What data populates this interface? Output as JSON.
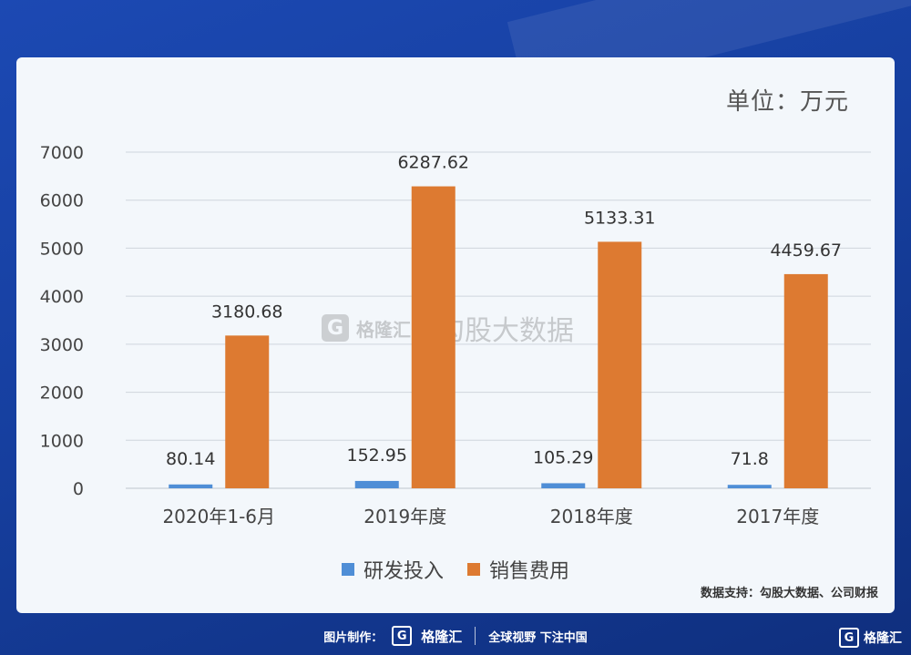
{
  "unit_label": "单位：万元",
  "watermark": {
    "brand": "格隆汇",
    "text": "勾股大数据",
    "logo_letter": "G"
  },
  "source": "数据支持：勾股大数据、公司财报",
  "footer": {
    "made_by": "图片制作：",
    "brand": "格隆汇",
    "slogan": "全球视野 下注中国",
    "logo_letter": "G"
  },
  "corner_brand": "格隆汇",
  "colors": {
    "series1": "#4f8ed6",
    "series2": "#dd7a31",
    "grid": "#cfd5dc",
    "text": "#444444"
  },
  "chart_data": {
    "type": "bar",
    "categories": [
      "2020年1-6月",
      "2019年度",
      "2018年度",
      "2017年度"
    ],
    "series": [
      {
        "name": "研发投入",
        "values": [
          80.14,
          152.95,
          105.29,
          71.8
        ],
        "labels": [
          "80.14",
          "152.95",
          "105.29",
          "71.8"
        ]
      },
      {
        "name": "销售费用",
        "values": [
          3180.68,
          6287.62,
          5133.31,
          4459.67
        ],
        "labels": [
          "3180.68",
          "6287.62",
          "5133.31",
          "4459.67"
        ]
      }
    ],
    "ylim": [
      0,
      7000
    ],
    "yticks": [
      0,
      1000,
      2000,
      3000,
      4000,
      5000,
      6000,
      7000
    ],
    "grid": true,
    "legend_position": "bottom"
  }
}
